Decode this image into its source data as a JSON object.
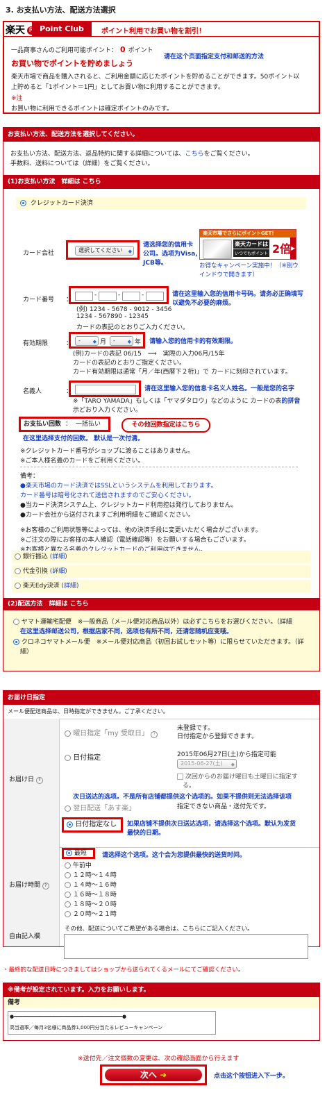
{
  "title": "3. お支払い方法、配送方法選択",
  "point": {
    "logo_kanji": "楽天",
    "logo_r": "R",
    "logo_text": "Point Club",
    "banner": "ポイント利用でお買い物を割引！",
    "avail_label": "一品商事さんのご利用可能ポイント：",
    "avail_value": "0",
    "avail_unit": "ポイント",
    "save_text": "お買い物でポイントを貯めましょう",
    "note_cn": "请在这个页面指定支付和邮送的方法",
    "desc1": "楽天市場で商品を購入されると、ご利用金額に応じたポイントを貯めることができます。50ポイント以",
    "desc2": "上貯めると「1ポイント＝1円」としてお買い物に利用することができます。",
    "note_mark": "※注",
    "note_text": "お買い物に利用できるポイントは確定ポイントのみです。"
  },
  "pay": {
    "header": "お支払い方法、配送方法を選択してください。",
    "intro1_a": "お支払い方法、配送方法、返品特約に関する詳細については、",
    "intro1_link": "こちら",
    "intro1_b": "をご覧ください。",
    "intro2": "手数料、送料については（詳細）をご覧ください。",
    "sec1": "(1)お支払い方法　詳細は こちら",
    "credit": "クレジットカード決済",
    "company_label": "カード会社",
    "colon": "：",
    "company_select": "選択してください",
    "company_cn1": "请选择您的信用卡",
    "company_cn2": "公司。选项为Visa,",
    "company_cn3": "JCB等。",
    "promo_top": "楽天市場でさらにポイントGET！",
    "promo_card": "楽天カードは",
    "promo_sub": "いつでもポイント",
    "promo_big": "2倍",
    "promo_link": "お得なキャンペーン実施中！（※別ウインドウで開きます）",
    "promo_link2": "別ウインドウで開きます）",
    "cardno_label": "カード番号",
    "cardno_cn1": "请在这里输入您的信用卡号码。请务必正确填写",
    "cardno_cn2": "以避免不必要的麻烦。",
    "cardno_ex1": "(例) 1234 - 5678 - 9012 - 3456",
    "cardno_ex2": "1234 - 567890 - 12345",
    "cardno_ex3": "カードの表記のとおりご入力ください。",
    "expiry_label": "有効期限",
    "expiry_month": "月",
    "expiry_year": "年",
    "expiry_dash": "-",
    "expiry_cn": "请输入您的信用卡的有效期限。",
    "expiry_ex1": "(例)カードの表記 06/15　⟹　実際の入力06月/15年",
    "expiry_ex2": "カードの表記のとおりご指定ください。",
    "expiry_ex3": "カード有効期限は通常「月／年(西暦下２桁)」で カードに刻印されています。",
    "name_label": "名義人",
    "name_cn": "请在这里输入您的信息卡名义人姓名。一般是您的名字",
    "name_ex1": "※「TARO YAMADA」もしくは「ヤマダタロウ」などのように カードの表",
    "name_cn2": "的拼音",
    "name_ex2": "示どおり入力ください。",
    "times_label": "お支払い回数",
    "times_value": "一括払い",
    "times_btn": "その他回数指定はこちら",
    "times_cn": "在这里选择支付的回数。 默认是一次付清。",
    "notice1": "※クレジットカード番号がショップに渡ることはありません。",
    "notice2": "※ご本人様名義のカードをご利用ください。",
    "remark_head": "備考：",
    "remark1": "●楽天市場のカード決済ではSSLというシステムを利用しております。",
    "remark2": "カード番号は暗号化されて送信されますのでご安心ください。",
    "remark3": "●当カード決済システム上、クレジットカード利用控は発行しておりません。",
    "remark4": "●カード会社から送付されますご利用明細をご確認ください。",
    "remark5": "※お客様のご利用状態等によっては、他の決済手段に変更いただく場合がございます。",
    "remark6": "※ご注文の際にお客様の本人確認（電話確認等）をお願いする場合もございます。",
    "remark7": "※お客様と異なる名義のクレジットカードのご利用はできません。",
    "bank": "銀行振込",
    "cod": "代金引換",
    "edy": "楽天Edy決済",
    "detail": "(詳細)"
  },
  "ship": {
    "sec2": "(2)配送方法　詳細は こちら",
    "yamato": "ヤマト運輸宅配便　※一般商品（メール便対応商品以外）は必ずこちらをお選びください。（詳細",
    "cn": "在这里选择邮送公司，根据店家不同，选项也有所不同，还请您随机应变哦。",
    "kuroneko": "クロネコヤマトメール便　※メール便対応商品（初回お試しセット等）に限らせていただきます。（詳",
    "detail_end": "細）"
  },
  "deliv": {
    "header": "お届け日指定",
    "note": "メール便配送商品は、日時指定ができません。ご了承ください。",
    "date_label": "お届け日",
    "opt1": "曜日指定「my 受取日」",
    "opt1_r1": "未登録です。",
    "opt1_r2": "日付指定から登録できます。",
    "opt2": "日付指定",
    "opt2_r1": "2015年06月27日(土)から指定可能",
    "opt2_sel": "2015-06-27(土)",
    "opt2_chk": "次回からのお届け曜日も土曜日に指定す",
    "opt2_chk2": "る。",
    "cn1": "次日送达的选项。不是所有店铺都提供这个选项的。如果不提供则无法选择该项",
    "opt3": "翌日配送「あす楽」",
    "opt3_r": "指定できない商品・送付先です。",
    "opt4": "日付指定なし",
    "opt4_cn1": "如果店铺不提供次日送达选项，请选择这个选项。默认为发货",
    "opt4_cn2": "最快的日期。",
    "time_label": "お届け時間",
    "time_opts": [
      "最短",
      "午前中",
      "１２時～１４時",
      "１４時～１６時",
      "１６時～１８時",
      "１８時～２０時",
      "２０時～２１時"
    ],
    "time_cn": "请选择这个选项。这个会为您提供最快的送货时间。",
    "free_label": "自由記入欄",
    "free_text": "その他、配送についてご希望がある場合は、こちらにご記入ください。",
    "final_note": "・最終的な配送日時につきましてはショップから送られてくるメールにてご確認ください。"
  },
  "memo": {
    "header": "※備考が設定されています。入力をお願いします。",
    "label": "備考",
    "line1": "●━━━━━━━━━━━━━━━━━━━━━━━━━━━━━━━━━━━━━●",
    "line2": "高当選率／毎月3名様に商品券1,000円分当たるレビューキャンペーン"
  },
  "footer": {
    "note": "※送付先／注文個数の変更は、次の確認画面から行えます",
    "next": "次へ",
    "cn": "点击这个按钮进入下一步。"
  }
}
